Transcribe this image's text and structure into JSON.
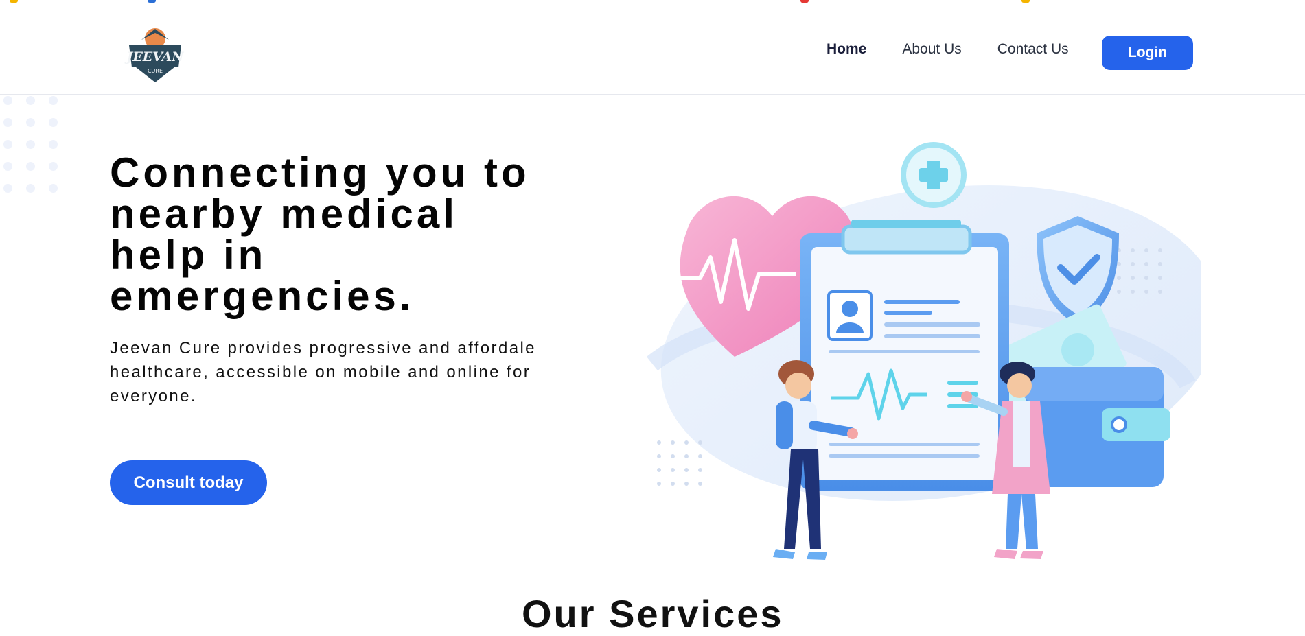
{
  "brand": {
    "logo_text": "JEEVAN",
    "logo_subtext": "CURE"
  },
  "nav": {
    "items": [
      {
        "label": "Home",
        "active": true
      },
      {
        "label": "About Us",
        "active": false
      },
      {
        "label": "Contact Us",
        "active": false
      }
    ],
    "login_label": "Login"
  },
  "hero": {
    "title_lines": [
      "Connecting you to",
      "nearby medical",
      "help in",
      "emergencies."
    ],
    "subtitle_lines": [
      "Jeevan Cure provides progressive and affordale",
      "healthcare, accessible on mobile and online for",
      "everyone."
    ],
    "cta_label": "Consult today"
  },
  "next_section": {
    "heading_peek": "Our Services"
  },
  "colors": {
    "primary": "#2563eb",
    "heart_pink": "#f3a3cc",
    "illustration_blue": "#5b9cf0",
    "accent_cyan": "#5ed3ea",
    "nav_text": "#2a3140"
  },
  "icons": [
    "logo-emblem",
    "heart-pulse-icon",
    "medical-cross-icon",
    "shield-check-icon",
    "clipboard-icon",
    "wallet-icon"
  ]
}
